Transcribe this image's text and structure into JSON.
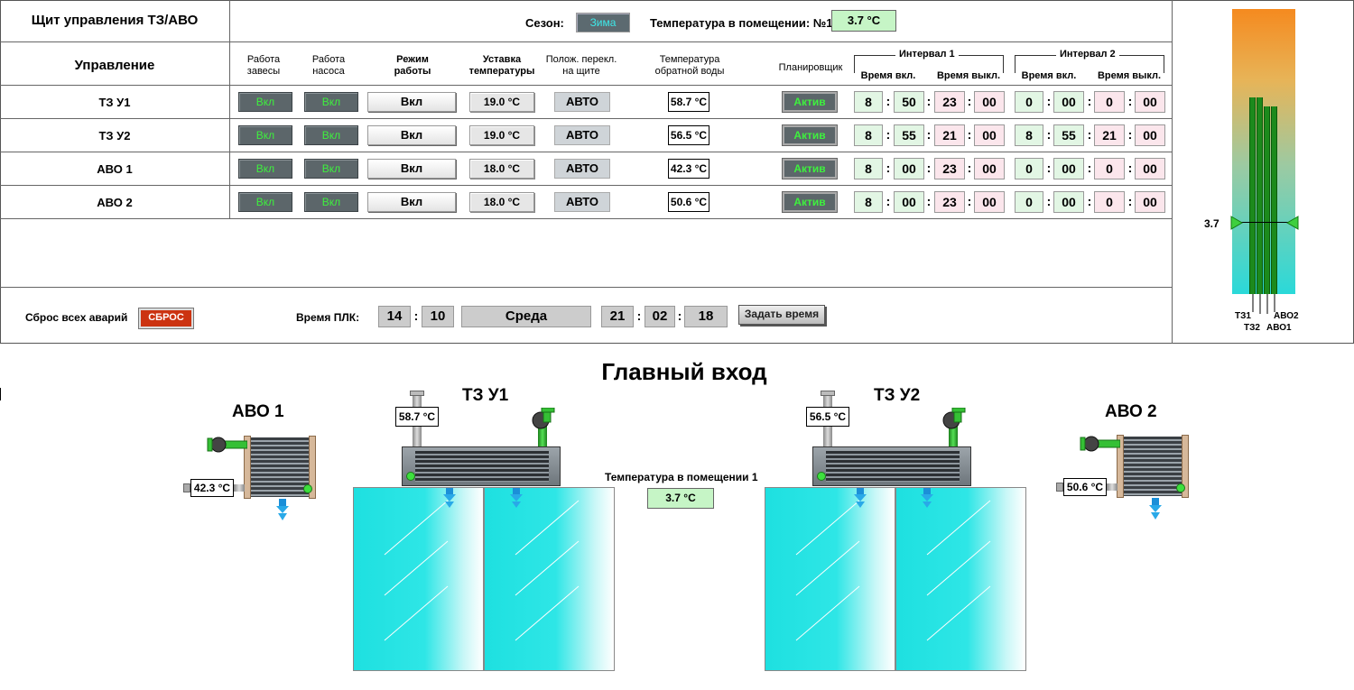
{
  "panel": {
    "title": "Щит управления ТЗ/АВО",
    "season_label": "Сезон:",
    "season_value": "Зима",
    "room_temp_label": "Температура в помещении: №1",
    "room_temp_value": "3.7 °C"
  },
  "table": {
    "control_header": "Управление",
    "columns": {
      "curtain_work": "Работа завесы",
      "pump_work": "Работа насоса",
      "mode": "Режим работы",
      "setpoint": "Уставка температуры",
      "switch_pos": "Полож. перекл. на щите",
      "return_temp": "Температура обратной воды",
      "scheduler": "Планировщик",
      "interval1": "Интервал 1",
      "interval2": "Интервал 2",
      "time_on": "Время вкл.",
      "time_off": "Время выкл."
    },
    "rows": [
      {
        "name": "ТЗ У1",
        "curtain": "Вкл",
        "pump": "Вкл",
        "mode": "Вкл",
        "setpoint": "19.0 °C",
        "switch": "АВТО",
        "return": "58.7 °C",
        "sched": "Актив",
        "i1_on_h": "8",
        "i1_on_m": "50",
        "i1_off_h": "23",
        "i1_off_m": "00",
        "i2_on_h": "0",
        "i2_on_m": "00",
        "i2_off_h": "0",
        "i2_off_m": "00"
      },
      {
        "name": "ТЗ У2",
        "curtain": "Вкл",
        "pump": "Вкл",
        "mode": "Вкл",
        "setpoint": "19.0 °C",
        "switch": "АВТО",
        "return": "56.5 °C",
        "sched": "Актив",
        "i1_on_h": "8",
        "i1_on_m": "55",
        "i1_off_h": "21",
        "i1_off_m": "00",
        "i2_on_h": "8",
        "i2_on_m": "55",
        "i2_off_h": "21",
        "i2_off_m": "00"
      },
      {
        "name": "АВО 1",
        "curtain": "Вкл",
        "pump": "Вкл",
        "mode": "Вкл",
        "setpoint": "18.0 °C",
        "switch": "АВТО",
        "return": "42.3 °C",
        "sched": "Актив",
        "i1_on_h": "8",
        "i1_on_m": "00",
        "i1_off_h": "23",
        "i1_off_m": "00",
        "i2_on_h": "0",
        "i2_on_m": "00",
        "i2_off_h": "0",
        "i2_off_m": "00"
      },
      {
        "name": "АВО 2",
        "curtain": "Вкл",
        "pump": "Вкл",
        "mode": "Вкл",
        "setpoint": "18.0 °C",
        "switch": "АВТО",
        "return": "50.6 °C",
        "sched": "Актив",
        "i1_on_h": "8",
        "i1_on_m": "00",
        "i1_off_h": "23",
        "i1_off_m": "00",
        "i2_on_h": "0",
        "i2_on_m": "00",
        "i2_off_h": "0",
        "i2_off_m": "00"
      }
    ]
  },
  "footer": {
    "reset_label": "Сброс всех аварий",
    "reset_button": "СБРОС",
    "plc_time_label": "Время ПЛК:",
    "plc_hour": "14",
    "plc_minute": "10",
    "plc_day": "Среда",
    "date_day": "21",
    "date_month": "02",
    "date_year": "18",
    "set_time_button": "Задать время"
  },
  "gauge": {
    "marker_value": "3.7",
    "bar_labels": [
      "ТЗ1",
      "ТЗ2",
      "АВО1",
      "АВО2"
    ]
  },
  "mimic": {
    "title": "Главный вход",
    "avo1_title": "АВО 1",
    "avo1_temp": "42.3 °C",
    "tz1_title": "ТЗ У1",
    "tz1_temp": "58.7 °C",
    "tz2_title": "ТЗ У2",
    "tz2_temp": "56.5 °C",
    "avo2_title": "АВО 2",
    "avo2_temp": "50.6 °C",
    "room_label": "Температура в помещении 1",
    "room_value": "3.7 °C"
  },
  "colors": {
    "on_green": "#3ef03e",
    "dark_button": "#5c666a",
    "gauge_top": "#f58a1f",
    "gauge_bottom": "#2ad9d9",
    "curtain": "#1ee0e0"
  }
}
